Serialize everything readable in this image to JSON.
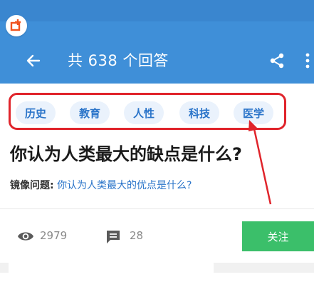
{
  "header": {
    "title": "共 638 个回答",
    "back_icon": "arrow-left-icon",
    "share_icon": "share-icon",
    "more_icon": "more-vert-icon",
    "app_badge_icon": "app-badge-icon",
    "background_color": "#3f8fd8",
    "badge_accent_color": "#f0531f"
  },
  "tags": [
    {
      "label": "历史"
    },
    {
      "label": "教育"
    },
    {
      "label": "人性"
    },
    {
      "label": "科技"
    },
    {
      "label": "医学"
    }
  ],
  "question": {
    "title": "你认为人类最大的缺点是什么?",
    "mirror_label": "镜像问题:",
    "mirror_link": "你认为人类最大的优点是什么?"
  },
  "stats": {
    "views_icon": "eye-icon",
    "views": "2979",
    "comments_icon": "comment-icon",
    "comments": "28",
    "follow_label": "关注",
    "follow_color": "#3bbf6a"
  },
  "annotation": {
    "highlight_color": "#e0242b"
  }
}
